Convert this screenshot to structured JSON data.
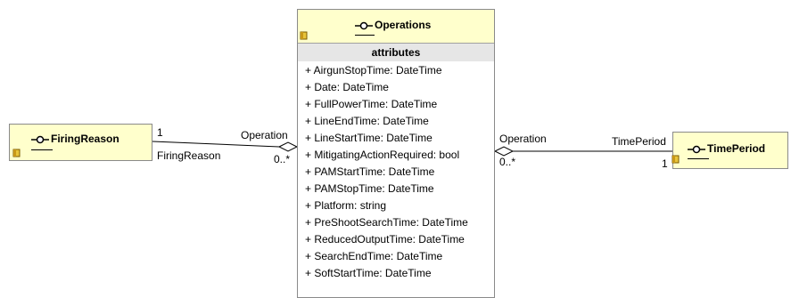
{
  "classes": {
    "operations": {
      "name": "Operations",
      "section": "attributes",
      "attributes": [
        "+ AirgunStopTime: DateTime",
        "+ Date: DateTime",
        "+ FullPowerTime: DateTime",
        "+ LineEndTime: DateTime",
        "+ LineStartTime: DateTime",
        "+ MitigatingActionRequired: bool",
        "+ PAMStartTime: DateTime",
        "+ PAMStopTime: DateTime",
        "+ Platform: string",
        "+ PreShootSearchTime: DateTime",
        "+ ReducedOutputTime: DateTime",
        "+ SearchEndTime: DateTime",
        "+ SoftStartTime: DateTime"
      ]
    },
    "firing_reason": {
      "name": "FiringReason"
    },
    "time_period": {
      "name": "TimePeriod"
    }
  },
  "associations": {
    "firing": {
      "source_multiplicity": "1",
      "source_role": "FiringReason",
      "target_role": "Operation",
      "target_multiplicity": "0..*"
    },
    "time": {
      "source_role": "Operation",
      "source_multiplicity": "0..*",
      "target_role": "TimePeriod",
      "target_multiplicity": "1"
    }
  },
  "colors": {
    "class_fill": "#ffffcc",
    "class_border": "#8a8a8a",
    "section_fill": "#e6e6e6"
  },
  "icons": [
    "interface-icon",
    "package-icon"
  ]
}
